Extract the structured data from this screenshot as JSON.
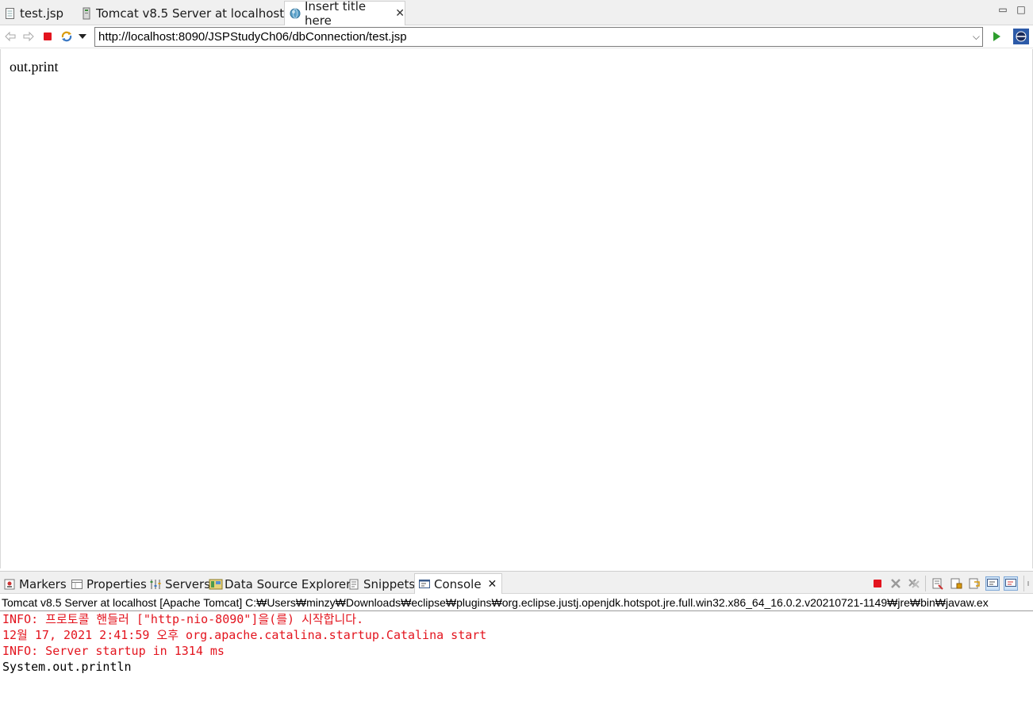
{
  "editor_tabs": [
    {
      "label": "test.jsp",
      "icon": "jsp-file-icon"
    },
    {
      "label": "Tomcat v8.5 Server at localhost",
      "icon": "server-icon"
    },
    {
      "label": "Insert title here",
      "icon": "web-browser-globe-icon",
      "active": true
    }
  ],
  "window_controls": {
    "minimize": "▭",
    "maximize": "□"
  },
  "browser": {
    "url": "http://localhost:8090/JSPStudyCh06/dbConnection/test.jsp",
    "page_text": "out.print"
  },
  "panel_tabs": [
    {
      "label": "Markers",
      "icon": "markers-icon"
    },
    {
      "label": "Properties",
      "icon": "properties-icon"
    },
    {
      "label": "Servers",
      "icon": "servers-icon"
    },
    {
      "label": "Data Source Explorer",
      "icon": "data-source-icon"
    },
    {
      "label": "Snippets",
      "icon": "snippets-icon"
    },
    {
      "label": "Console",
      "icon": "console-icon",
      "active": true
    }
  ],
  "console": {
    "header": "Tomcat v8.5 Server at localhost [Apache Tomcat] C:₩Users₩minzy₩Downloads₩eclipse₩plugins₩org.eclipse.justj.openjdk.hotspot.jre.full.win32.x86_64_16.0.2.v20210721-1149₩jre₩bin₩javaw.ex",
    "lines": [
      {
        "text": "INFO: 프로토콜 핸들러 [\"http-nio-8090\"]을(를) 시작합니다.",
        "type": "err"
      },
      {
        "text": "12월 17, 2021 2:41:59 오후 org.apache.catalina.startup.Catalina start",
        "type": "err"
      },
      {
        "text": "INFO: Server startup in 1314 ms",
        "type": "err"
      },
      {
        "text": "System.out.println",
        "type": "out"
      }
    ]
  },
  "colors": {
    "stderr": "#e3141e",
    "stdout": "#000000",
    "run_green": "#2e9e2e",
    "stop_red": "#e3141e"
  }
}
